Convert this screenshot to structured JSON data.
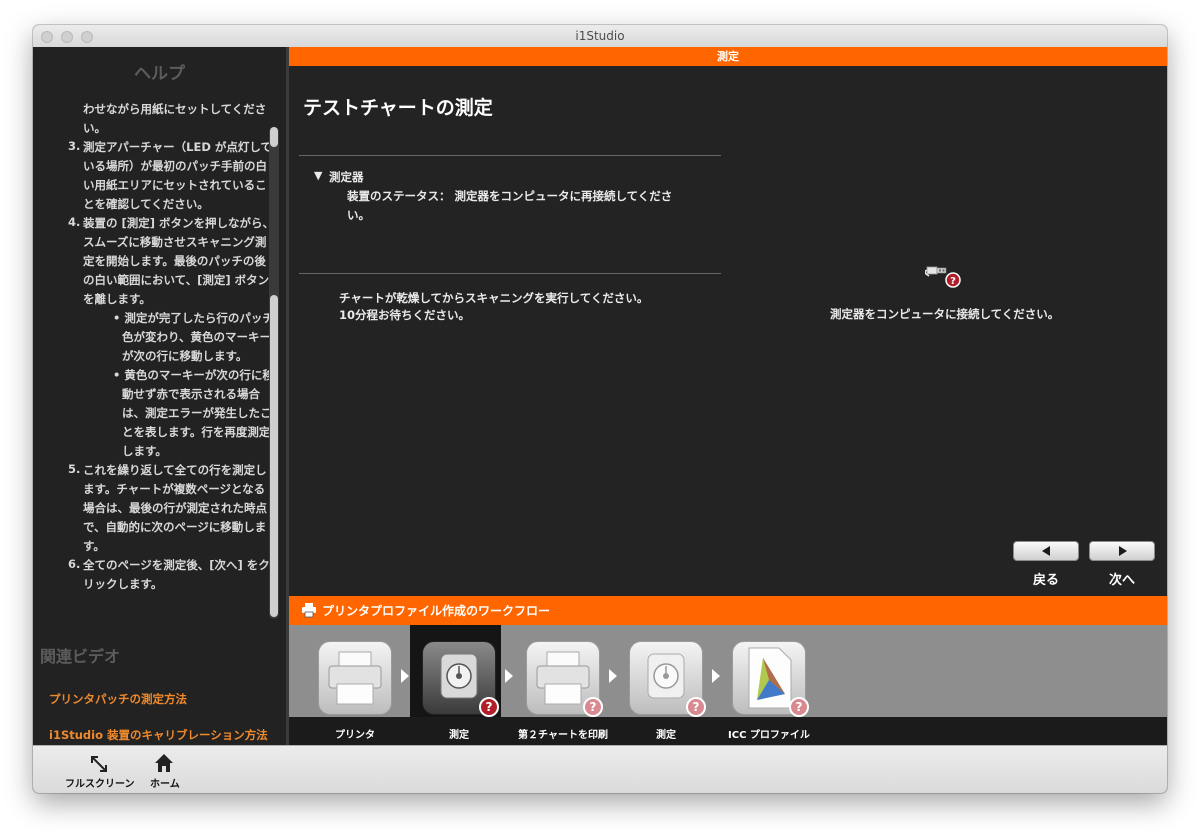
{
  "window": {
    "title": "i1Studio"
  },
  "help": {
    "title": "ヘルプ",
    "lines": [
      "わせながら用紙にセットしてくださ",
      "い。",
      "3.",
      "測定アパーチャー（LED が点灯して",
      "いる場所）が最初のパッチ手前の白",
      "い用紙エリアにセットされているこ",
      "とを確認してください。",
      "4.",
      "装置の [測定] ボタンを押しながら、",
      "スムーズに移動させスキャニング測",
      "定を開始します。最後のパッチの後",
      "の白い範囲において、[測定] ボタン",
      "を離します。",
      "• 測定が完了したら行のパッチ",
      "色が変わり、黄色のマーキー",
      "が次の行に移動します。",
      "• 黄色のマーキーが次の行に移",
      "動せず赤で表示される場合",
      "は、測定エラーが発生したこ",
      "とを表します。行を再度測定",
      "します。",
      "5.",
      "これを繰り返して全ての行を測定し",
      "ます。チャートが複数ページとなる",
      "場合は、最後の行が測定された時点",
      "で、自動的に次のページに移動しま",
      "す。",
      "6.",
      "全てのページを測定後、[次へ] をク",
      "リックします。"
    ],
    "related_title": "関連ビデオ",
    "links": [
      "プリンタパッチの測定方法",
      "i1Studio 装置のキャリブレーション方法"
    ]
  },
  "banner": {
    "label": "測定"
  },
  "main": {
    "title": "テストチャートの測定",
    "section_label": "測定器",
    "status_line1": "装置のステータス： 測定器をコンピュータに再接続してくださ",
    "status_line2": "い。",
    "instruction_line1": "チャートが乾燥してからスキャニングを実行してください。",
    "instruction_line2": "10分程お待ちください。",
    "connect_message": "測定器をコンピュータに接続してください。",
    "back_label": "戻る",
    "next_label": "次へ"
  },
  "workflow": {
    "title": "プリンタプロファイル作成のワークフロー",
    "steps": [
      {
        "label": "プリンタ",
        "icon": "printer-icon"
      },
      {
        "label": "測定",
        "icon": "measure-device-icon"
      },
      {
        "label": "第２チャートを印刷",
        "icon": "printer-icon"
      },
      {
        "label": "測定",
        "icon": "measure-device-icon"
      },
      {
        "label": "ICC プロファイル",
        "icon": "icc-profile-icon"
      }
    ],
    "active_step": 1
  },
  "bottombar": {
    "fullscreen_label": "フルスクリーン",
    "home_label": "ホーム"
  },
  "colors": {
    "accent": "#ff6600",
    "link": "#f08a2c",
    "error": "#b01e2a"
  }
}
